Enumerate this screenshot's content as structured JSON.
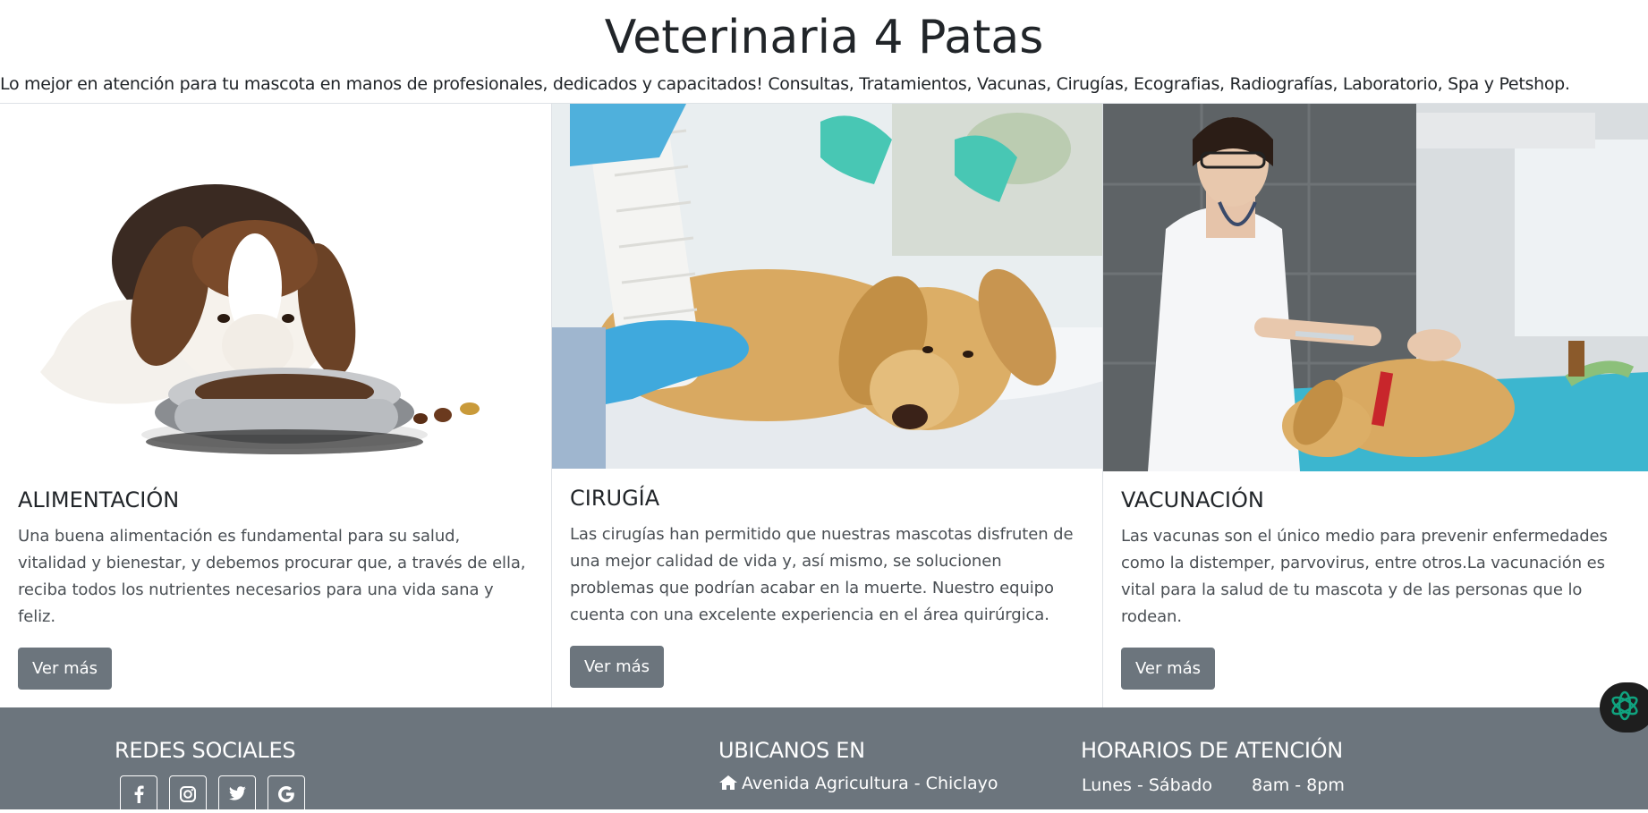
{
  "header": {
    "title": "Veterinaria 4 Patas",
    "tagline": "Lo mejor en atención para tu mascota en manos de profesionales, dedicados y capacitados! Consultas, Tratamientos, Vacunas, Cirugías, Ecografias, Radiografías, Laboratorio, Spa y Petshop."
  },
  "cards": [
    {
      "image_icon": "puppy-eating-photo",
      "title": "ALIMENTACIÓN",
      "text": "Una buena alimentación es fundamental para su salud, vitalidad y bienestar, y debemos procurar que, a través de ella, reciba todos los nutrientes necesarios para una vida sana y feliz.",
      "button": "Ver más"
    },
    {
      "image_icon": "dog-surgery-photo",
      "title": "CIRUGÍA",
      "text": "Las cirugías han permitido que nuestras mascotas disfruten de una mejor calidad de vida y, así mismo, se solucionen problemas que podrían acabar en la muerte. Nuestro equipo cuenta con una excelente experiencia en el área quirúrgica.",
      "button": "Ver más"
    },
    {
      "image_icon": "dog-vaccination-photo",
      "title": "VACUNACIÓN",
      "text": "Las vacunas son el único medio para prevenir enfermedades como la distemper, parvovirus, entre otros.La vacunación es vital para la salud de tu mascota y de las personas que lo rodean.",
      "button": "Ver más"
    }
  ],
  "footer": {
    "social_title": "REDES SOCIALES",
    "social_icons": [
      "facebook-icon",
      "instagram-icon",
      "twitter-icon",
      "google-icon"
    ],
    "location_title": "UBICANOS EN",
    "address_icon": "home-icon",
    "address": "Avenida Agricultura - Chiclayo",
    "hours_title": "HORARIOS DE ATENCIÓN",
    "hours_days": "Lunes - Sábado",
    "hours_time": "8am - 8pm"
  },
  "colors": {
    "footer_bg": "#6c757d",
    "button_bg": "#6c757d",
    "text_dark": "#212529",
    "floating_button_bg": "#1e1e1e",
    "floating_icon": "#10a37f"
  },
  "floating_button_icon": "openai-logo-icon"
}
